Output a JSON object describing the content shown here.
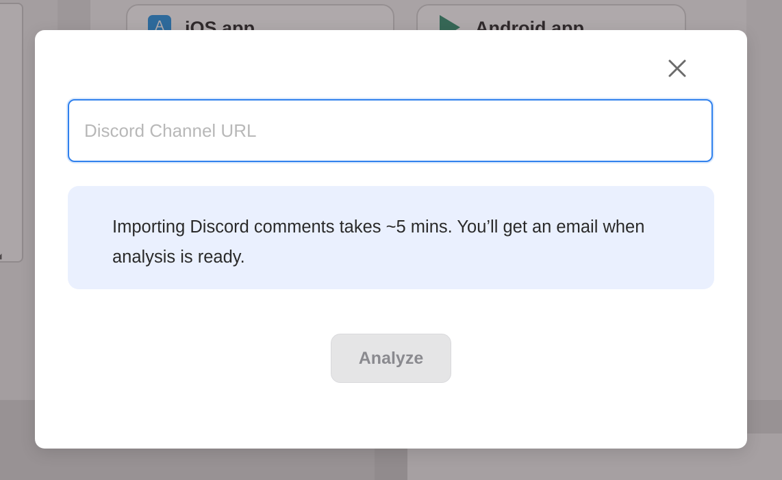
{
  "background": {
    "cards": [
      {
        "label": "iOS app",
        "icon": "app-store-icon"
      },
      {
        "label": "Android app",
        "icon": "google-play-icon"
      }
    ]
  },
  "modal": {
    "close_icon": "close-icon",
    "url_input": {
      "placeholder": "Discord Channel URL",
      "value": ""
    },
    "info_text": "Importing Discord comments takes ~5 mins. You’ll get an email when analysis is ready.",
    "analyze_label": "Analyze",
    "analyze_disabled": true
  },
  "colors": {
    "input_focus_border": "#2f80ed",
    "info_background": "#eaf0fe",
    "button_disabled_bg": "#e5e5e6",
    "button_disabled_text": "#8a8a8f"
  }
}
